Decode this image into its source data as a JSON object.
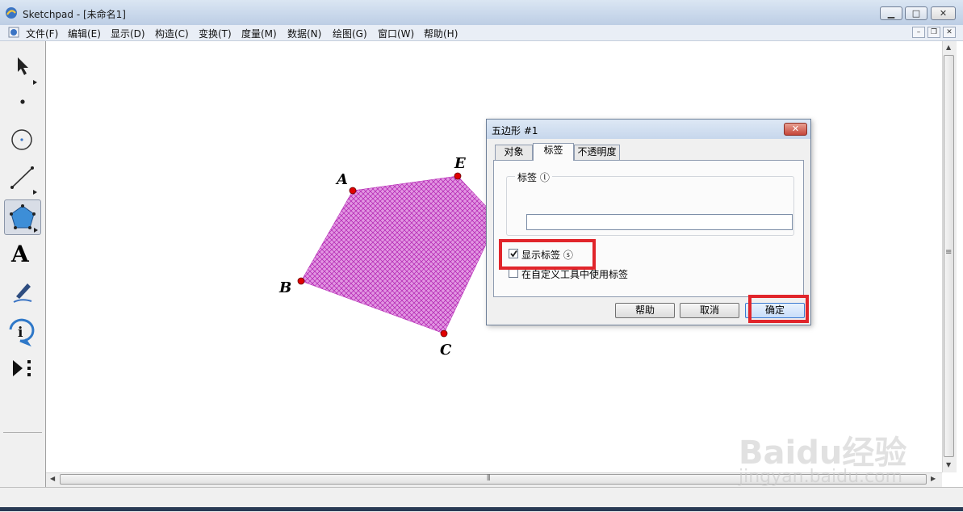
{
  "window": {
    "title": "Sketchpad  - [未命名1]",
    "controls": {
      "minimize": "▭",
      "maximize": "□",
      "close": "✕"
    }
  },
  "menubar": {
    "items": [
      "文件(F)",
      "编辑(E)",
      "显示(D)",
      "构造(C)",
      "变换(T)",
      "度量(M)",
      "数据(N)",
      "绘图(G)",
      "窗口(W)",
      "帮助(H)"
    ]
  },
  "toolbox": {
    "tools": [
      "arrow-tool-icon",
      "point-tool-icon",
      "compass-tool-icon",
      "straightedge-tool-icon",
      "polygon-tool-icon",
      "text-tool-icon",
      "marker-tool-icon",
      "information-tool-icon",
      "custom-tool-icon"
    ],
    "text_tool_glyph": "A",
    "info_tool_glyph": "i",
    "selected": "polygon-tool-icon"
  },
  "canvas": {
    "points": [
      "A",
      "E",
      "B",
      "C"
    ],
    "polygon_fill": "#cc44cc",
    "point_color": "#cc0000"
  },
  "dialog": {
    "title": "五边形 #1",
    "close": "✕",
    "tabs": [
      "对象",
      "标签",
      "不透明度"
    ],
    "active_tab": "标签",
    "label_group": "标签 ⓛ",
    "label_value": "",
    "show_label": {
      "text": "显示标签 ⓢ",
      "checked": true
    },
    "custom_tool_label": {
      "text": "在自定义工具中使用标签",
      "checked": false
    },
    "buttons": {
      "help": "帮助",
      "cancel": "取消",
      "ok": "确定"
    },
    "highlight_color": "#e1252b"
  },
  "watermark": {
    "brand": "Baidu经验",
    "url": "jingyan.baidu.com"
  },
  "scroll": {
    "h_grip": "⦀",
    "v_grip": "≡"
  }
}
